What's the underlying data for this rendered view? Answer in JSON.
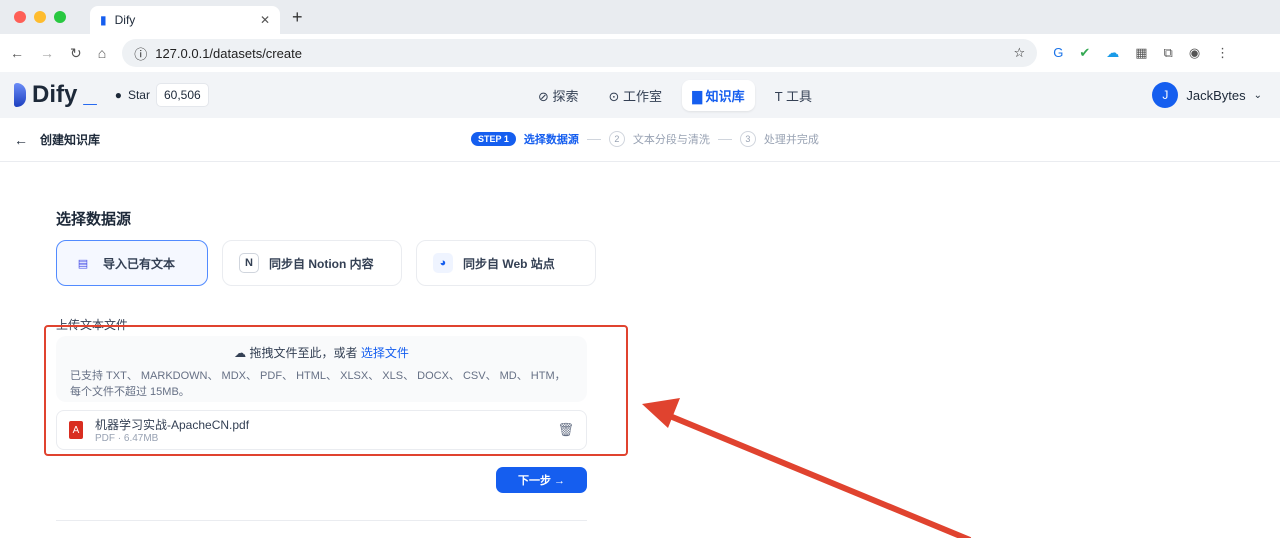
{
  "browser": {
    "tab_title": "Dify",
    "url": "127.0.0.1/datasets/create"
  },
  "header": {
    "logo": "Dify",
    "star_label": "Star",
    "star_count": "60,506",
    "nav": [
      {
        "label": "探索"
      },
      {
        "label": "工作室"
      },
      {
        "label": "知识库"
      },
      {
        "label": "工具"
      }
    ],
    "user": {
      "initial": "J",
      "name": "JackBytes"
    }
  },
  "subheader": {
    "back_title": "创建知识库",
    "steps": [
      {
        "badge": "STEP 1",
        "label": "选择数据源"
      },
      {
        "num": "2",
        "label": "文本分段与清洗"
      },
      {
        "num": "3",
        "label": "处理并完成"
      }
    ]
  },
  "main": {
    "title": "选择数据源",
    "sources": [
      {
        "label": "导入已有文本"
      },
      {
        "label": "同步自 Notion 内容"
      },
      {
        "label": "同步自 Web 站点"
      }
    ],
    "upload_label": "上传文本文件",
    "drop_text": "拖拽文件至此，或者",
    "drop_link": "选择文件",
    "supported": "已支持 TXT、 MARKDOWN、 MDX、 PDF、 HTML、 XLSX、 XLS、 DOCX、 CSV、 MD、 HTM，每个文件不超过 15MB。",
    "file": {
      "name": "机器学习实战-ApacheCN.pdf",
      "type": "PDF",
      "size": "6.47MB"
    },
    "next_label": "下一步 →"
  },
  "colors": {
    "accent": "#155eef",
    "highlight": "#e0432f"
  }
}
